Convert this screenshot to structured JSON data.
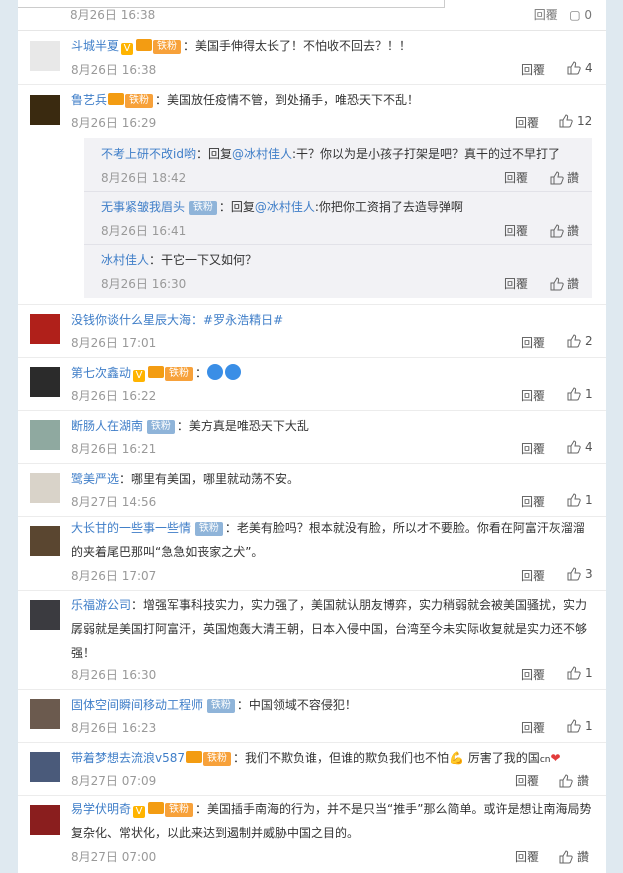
{
  "top": {
    "meta": "8月26日 16:38",
    "reply_label": "回覆",
    "like_label": "0"
  },
  "reply_label": "回覆",
  "like_label": "讚",
  "comments": [
    {
      "user": "斗城半夏",
      "badges": [
        "v",
        "lvl",
        "铁粉"
      ],
      "text": "：美国手伸得太长了！不怕收不回去？！！",
      "time": "8月26日 16:38",
      "likes": "4"
    },
    {
      "user": "鲁艺兵",
      "badges": [
        "lvl",
        "铁粉"
      ],
      "text": "：美国放任疫情不管，到处捅手，唯恐天下不乱！",
      "time": "8月26日 16:29",
      "likes": "12",
      "replies": [
        {
          "user": "不考上研不改id哟",
          "text": "：回复",
          "mention": "@冰村佳人",
          "tail": ":干？你以为是小孩子打架是吧？真干的过不早打了",
          "time": "8月26日 18:42"
        },
        {
          "user": "无事紧皱我眉头",
          "fan": "铁粉",
          "text": "：回复",
          "mention": "@冰村佳人",
          "tail": ":你把你工资捐了去造导弹啊",
          "time": "8月26日 16:41"
        },
        {
          "user": "冰村佳人",
          "text": "：干它一下又如何？",
          "time": "8月26日 16:30"
        }
      ]
    },
    {
      "user": "没钱你谈什么星辰大海",
      "text": "：#罗永浩精日#",
      "time": "8月26日 17:01",
      "likes": "2"
    },
    {
      "user": "第七次鑫动",
      "badges": [
        "v",
        "lvl",
        "铁粉"
      ],
      "text": "：",
      "emojis": 2,
      "time": "8月26日 16:22",
      "likes": "1"
    },
    {
      "user": "断肠人在湖南",
      "badges": [
        "铁粉blue"
      ],
      "text": "：美方真是唯恐天下大乱",
      "time": "8月26日 16:21",
      "likes": "4"
    },
    {
      "user": "鹭美严选",
      "text": "：哪里有美国，哪里就动荡不安。",
      "time": "8月27日 14:56",
      "likes": "1"
    },
    {
      "user": "大长甘的一些事一些情",
      "badges": [
        "铁粉blue"
      ],
      "text": "：老美有脸吗？根本就没有脸，所以才不要脸。你看在阿富汗灰溜溜的夹着尾巴那叫“急急如丧家之犬”。",
      "time": "8月26日 17:07",
      "likes": "3"
    },
    {
      "user": "乐福游公司",
      "text": "：增强军事科技实力，实力强了，美国就认朋友博弈，实力稍弱就会被美国骚扰，实力孱弱就是美国打阿富汗，英国炮轰大清王朝，日本入侵中国，台湾至今未实际收复就是实力还不够强！",
      "time": "8月26日 16:30",
      "likes": "1"
    },
    {
      "user": "固体空间瞬间移动工程师",
      "badges": [
        "铁粉blue"
      ],
      "text": "：中国领域不容侵犯！",
      "time": "8月26日 16:23",
      "likes": "1"
    },
    {
      "user": "带着梦想去流浪v587",
      "badges": [
        "lvl",
        "铁粉"
      ],
      "text": "：我们不欺负谁，但谁的欺负我们也不怕",
      "text2": " 厉害了我的国",
      "suffix": "cn",
      "time": "8月27日 07:09",
      "likes": "讚"
    },
    {
      "user": "易学伏明奇",
      "badges": [
        "v",
        "lvl",
        "铁粉"
      ],
      "text": "：美国插手南海的行为，并不是只当“推手”那么简单。或许是想让南海局势复杂化、常状化，以此来达到遏制并威胁中国之目的。",
      "time": "8月27日 07:00",
      "likes": "讚"
    }
  ],
  "colors": {
    "link": "#3f7ec8",
    "badge": "#f7a13a",
    "fan_blue": "#8fb4d9",
    "bg": "#dfe9f0"
  }
}
